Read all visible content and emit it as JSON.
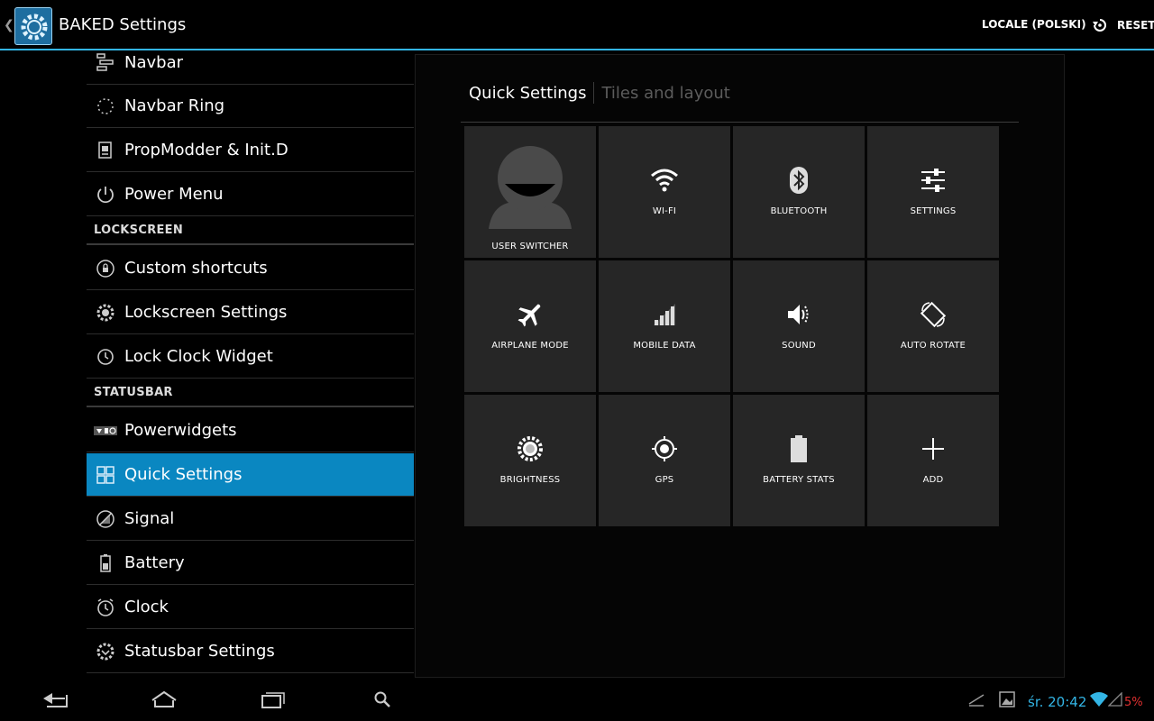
{
  "actionbar": {
    "title": "BAKED Settings",
    "locale_label": "LOCALE (POLSKI)",
    "reset_label": "RESET",
    "icons": {
      "app": "gear-app-icon",
      "reset": "reset-icon",
      "up": "up-caret-icon"
    },
    "accent": "#33b5e5"
  },
  "sidebar": {
    "items": [
      {
        "label": "Navbar",
        "icon": "navbar-icon"
      },
      {
        "label": "Navbar Ring",
        "icon": "ring-icon"
      },
      {
        "label": "PropModder & Init.D",
        "icon": "propmodder-icon"
      },
      {
        "label": "Power Menu",
        "icon": "power-icon"
      },
      {
        "label": "Custom shortcuts",
        "icon": "lock-shortcut-icon"
      },
      {
        "label": "Lockscreen Settings",
        "icon": "lock-gear-icon"
      },
      {
        "label": "Lock Clock Widget",
        "icon": "clock-icon"
      },
      {
        "label": "Powerwidgets",
        "icon": "powerwidgets-icon"
      },
      {
        "label": "Quick Settings",
        "icon": "quick-settings-icon",
        "selected": true
      },
      {
        "label": "Signal",
        "icon": "signal-icon"
      },
      {
        "label": "Battery",
        "icon": "battery-icon"
      },
      {
        "label": "Clock",
        "icon": "alarm-clock-icon"
      },
      {
        "label": "Statusbar Settings",
        "icon": "statusbar-gear-icon"
      }
    ],
    "sections": {
      "lockscreen": "LOCKSCREEN",
      "statusbar": "STATUSBAR"
    },
    "selected_color": "#0a87c1"
  },
  "main": {
    "tab_active": "Quick Settings",
    "tab_inactive": "Tiles and layout",
    "tiles": [
      {
        "label": "USER SWITCHER",
        "icon": "user-avatar-icon"
      },
      {
        "label": "WI-FI",
        "icon": "wifi-icon"
      },
      {
        "label": "BLUETOOTH",
        "icon": "bluetooth-icon"
      },
      {
        "label": "SETTINGS",
        "icon": "sliders-icon"
      },
      {
        "label": "AIRPLANE MODE",
        "icon": "airplane-icon"
      },
      {
        "label": "MOBILE DATA",
        "icon": "mobile-data-icon"
      },
      {
        "label": "SOUND",
        "icon": "speaker-icon"
      },
      {
        "label": "AUTO ROTATE",
        "icon": "rotate-icon"
      },
      {
        "label": "BRIGHTNESS",
        "icon": "brightness-icon"
      },
      {
        "label": "GPS",
        "icon": "gps-icon"
      },
      {
        "label": "BATTERY STATS",
        "icon": "battery-stats-icon"
      },
      {
        "label": "ADD",
        "icon": "plus-icon"
      }
    ]
  },
  "statusbar": {
    "time": "śr. 20:42",
    "battery_percent": "5%",
    "nav_icons": [
      "back-icon",
      "home-icon",
      "recents-icon",
      "search-icon"
    ],
    "status_icons": [
      "usb-debug-icon",
      "image-notification-icon",
      "wifi-status-icon",
      "signal-status-icon"
    ],
    "battery_color": "#e03030"
  }
}
